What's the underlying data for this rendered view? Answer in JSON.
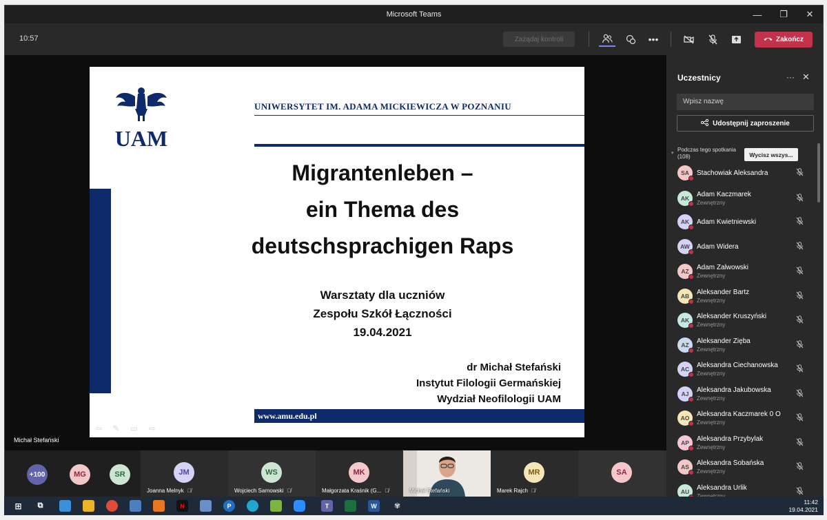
{
  "window": {
    "title": "Microsoft Teams"
  },
  "toolbar": {
    "time": "10:57",
    "request_control_label": "Zażądaj kontroli",
    "end_call_label": "Zakończ"
  },
  "slide": {
    "university": "Uniwersytet im. Adama Mickiewicza w Poznaniu",
    "logo_text": "UAM",
    "title_lines": [
      "Migrantenleben –",
      "ein Thema des",
      "deutschsprachigen Raps"
    ],
    "subtitle_lines": [
      "Warsztaty dla uczniów",
      "Zespołu Szkół Łączności",
      "19.04.2021"
    ],
    "author_lines": [
      "dr Michał Stefański",
      "Instytut Filologii Germańskiej",
      "Wydział Neofilologii UAM"
    ],
    "url": "www.amu.edu.pl"
  },
  "presenter": {
    "name": "Michał Stefański"
  },
  "gallery": {
    "overflow_count": "+100",
    "tiles": [
      {
        "initials": "MG",
        "name": ""
      },
      {
        "initials": "SR",
        "name": ""
      },
      {
        "initials": "JM",
        "name": "Joanna Melnyk"
      },
      {
        "initials": "WS",
        "name": "Wojciech Sarnowski"
      },
      {
        "initials": "MK",
        "name": "Małgorzata Kraśnik (G..."
      },
      {
        "initials": "",
        "name": "Michał Stefański"
      },
      {
        "initials": "MR",
        "name": "Marek Rajch"
      },
      {
        "initials": "SA",
        "name": ""
      }
    ]
  },
  "panel": {
    "title": "Uczestnicy",
    "search_placeholder": "Wpisz nazwę",
    "share_label": "Udostępnij zaproszenie",
    "section_label": "Podczas tego spotkania",
    "section_count": "(108)",
    "mute_all_label": "Wycisz wszys...",
    "participants": [
      {
        "initials": "SA",
        "name": "Stachowiak Aleksandra",
        "sub": "",
        "color": "#f4c7c9"
      },
      {
        "initials": "AK",
        "name": "Adam Kaczmarek",
        "sub": "Zewnętrzny",
        "color": "#c8e8d8"
      },
      {
        "initials": "AK",
        "name": "Adam Kwietniewski",
        "sub": "",
        "color": "#d4d2f5"
      },
      {
        "initials": "AW",
        "name": "Adam Widera",
        "sub": "",
        "color": "#d4d2f5"
      },
      {
        "initials": "AZ",
        "name": "Adam Zalwowski",
        "sub": "Zewnętrzny",
        "color": "#f4c7c9"
      },
      {
        "initials": "AB",
        "name": "Aleksander Bartz",
        "sub": "Zewnętrzny",
        "color": "#f5e6b8"
      },
      {
        "initials": "AK",
        "name": "Aleksander Kruszyński",
        "sub": "Zewnętrzny",
        "color": "#c8e8e4"
      },
      {
        "initials": "AZ",
        "name": "Aleksander Zięba",
        "sub": "Zewnętrzny",
        "color": "#c9d9ee"
      },
      {
        "initials": "AC",
        "name": "Aleksandra Ciechanowska",
        "sub": "Zewnętrzny",
        "color": "#d4d2f5"
      },
      {
        "initials": "AJ",
        "name": "Aleksandra Jakubowska",
        "sub": "Zewnętrzny",
        "color": "#d4d2f5"
      },
      {
        "initials": "AO",
        "name": "Aleksandra Kaczmarek 0 O",
        "sub": "Zewnętrzny",
        "color": "#f5e6b8"
      },
      {
        "initials": "AP",
        "name": "Aleksandra Przybylak",
        "sub": "Zewnętrzny",
        "color": "#f4c7d6"
      },
      {
        "initials": "AS",
        "name": "Aleksandra Sobańska",
        "sub": "Zewnętrzny",
        "color": "#f4c7c9"
      },
      {
        "initials": "AU",
        "name": "Aleksandra Urlik",
        "sub": "Zewnętrzny",
        "color": "#c8e8d8"
      }
    ]
  },
  "taskbar": {
    "time": "11:42",
    "date": "19.04.2021"
  }
}
